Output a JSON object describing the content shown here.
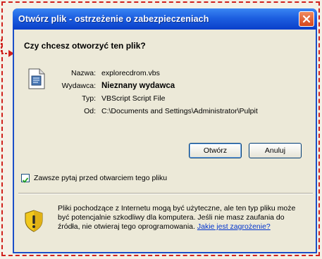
{
  "window": {
    "title": "Otwórz plik - ostrzeżenie o zabezpieczeniach",
    "close_icon": "close-icon"
  },
  "dialog": {
    "question": "Czy chcesz otworzyć ten plik?",
    "file_icon": "vbscript-file-icon",
    "fields": [
      {
        "label": "Nazwa:",
        "value": "explorecdrom.vbs"
      },
      {
        "label": "Wydawca:",
        "value": "Nieznany wydawca"
      },
      {
        "label": "Typ:",
        "value": "VBScript Script File"
      },
      {
        "label": "Od:",
        "value": "C:\\Documents and Settings\\Administrator\\Pulpit"
      }
    ],
    "buttons": {
      "open": "Otwórz",
      "cancel": "Anuluj"
    },
    "checkbox": {
      "label": "Zawsze pytaj przed otwarciem tego pliku",
      "checked": true
    },
    "warning": {
      "icon": "shield-warning-icon",
      "text": "Pliki pochodzące z Internetu mogą być użyteczne, ale ten typ pliku może być potencjalnie szkodliwy dla komputera. Jeśli nie masz zaufania do źródła, nie otwieraj tego oprogramowania.",
      "link": "Jakie jest zagrożenie?"
    }
  },
  "colors": {
    "titlebar": "#0a3fca",
    "callout": "#d0211d",
    "link": "#0033cc"
  }
}
